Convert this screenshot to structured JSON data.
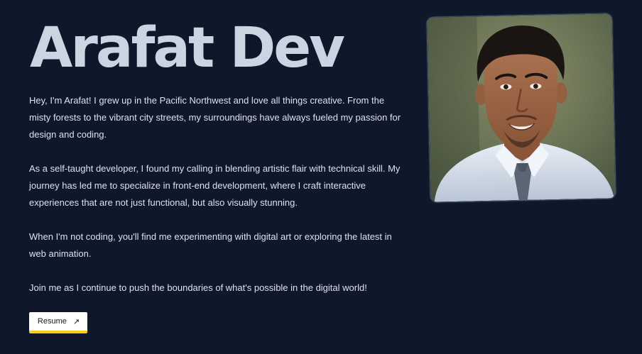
{
  "hero": {
    "title": "Arafat Dev"
  },
  "bio": {
    "paragraphs": [
      "Hey, I'm Arafat! I grew up in the Pacific Northwest and love all things creative. From the misty forests to the vibrant city streets, my surroundings have always fueled my passion for design and coding.",
      "As a self-taught developer, I found my calling in blending artistic flair with technical skill. My journey has led me to specialize in front-end development, where I craft interactive experiences that are not just functional, but also visually stunning.",
      "When I'm not coding, you'll find me experimenting with digital art or exploring the latest in web animation.",
      "Join me as I continue to push the boundaries of what's possible in the digital world!"
    ]
  },
  "resume_button": {
    "label": "Resume",
    "icon": "arrow-up-right-icon",
    "arrow": "↗"
  },
  "colors": {
    "background": "#0f172a",
    "title": "#cbd5e1",
    "text": "#dbe3ee",
    "button_bg": "#ffffff",
    "button_accent": "#facc15"
  }
}
